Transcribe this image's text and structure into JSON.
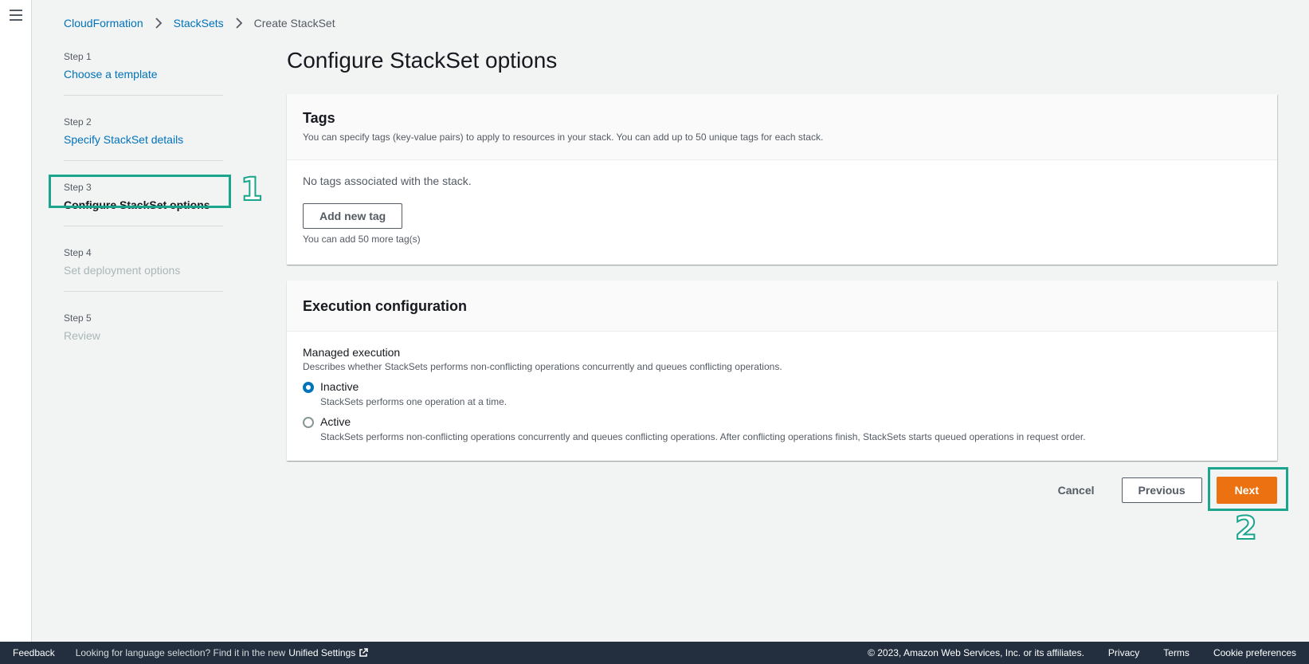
{
  "breadcrumb": {
    "items": [
      "CloudFormation",
      "StackSets"
    ],
    "current": "Create StackSet"
  },
  "steps": [
    {
      "num": "Step 1",
      "label": "Choose a template",
      "state": "link"
    },
    {
      "num": "Step 2",
      "label": "Specify StackSet details",
      "state": "link"
    },
    {
      "num": "Step 3",
      "label": "Configure StackSet options",
      "state": "current"
    },
    {
      "num": "Step 4",
      "label": "Set deployment options",
      "state": "disabled"
    },
    {
      "num": "Step 5",
      "label": "Review",
      "state": "disabled"
    }
  ],
  "page_title": "Configure StackSet options",
  "tags_panel": {
    "title": "Tags",
    "description": "You can specify tags (key-value pairs) to apply to resources in your stack. You can add up to 50 unique tags for each stack.",
    "empty_text": "No tags associated with the stack.",
    "add_button": "Add new tag",
    "hint": "You can add 50 more tag(s)"
  },
  "execution_panel": {
    "title": "Execution configuration",
    "field_label": "Managed execution",
    "field_desc": "Describes whether StackSets performs non-conflicting operations concurrently and queues conflicting operations.",
    "options": [
      {
        "label": "Inactive",
        "desc": "StackSets performs one operation at a time.",
        "selected": true
      },
      {
        "label": "Active",
        "desc": "StackSets performs non-conflicting operations concurrently and queues conflicting operations. After conflicting operations finish, StackSets starts queued operations in request order.",
        "selected": false
      }
    ]
  },
  "actions": {
    "cancel": "Cancel",
    "previous": "Previous",
    "next": "Next"
  },
  "annotations": [
    "1",
    "2"
  ],
  "footer": {
    "feedback": "Feedback",
    "lang_prompt": "Looking for language selection? Find it in the new",
    "unified_settings": "Unified Settings",
    "copyright": "© 2023, Amazon Web Services, Inc. or its affiliates.",
    "privacy": "Privacy",
    "terms": "Terms",
    "cookie": "Cookie preferences"
  },
  "colors": {
    "link": "#0073bb",
    "primary": "#ec7211",
    "annotation": "#1aa58c",
    "footer_bg": "#232f3e"
  }
}
